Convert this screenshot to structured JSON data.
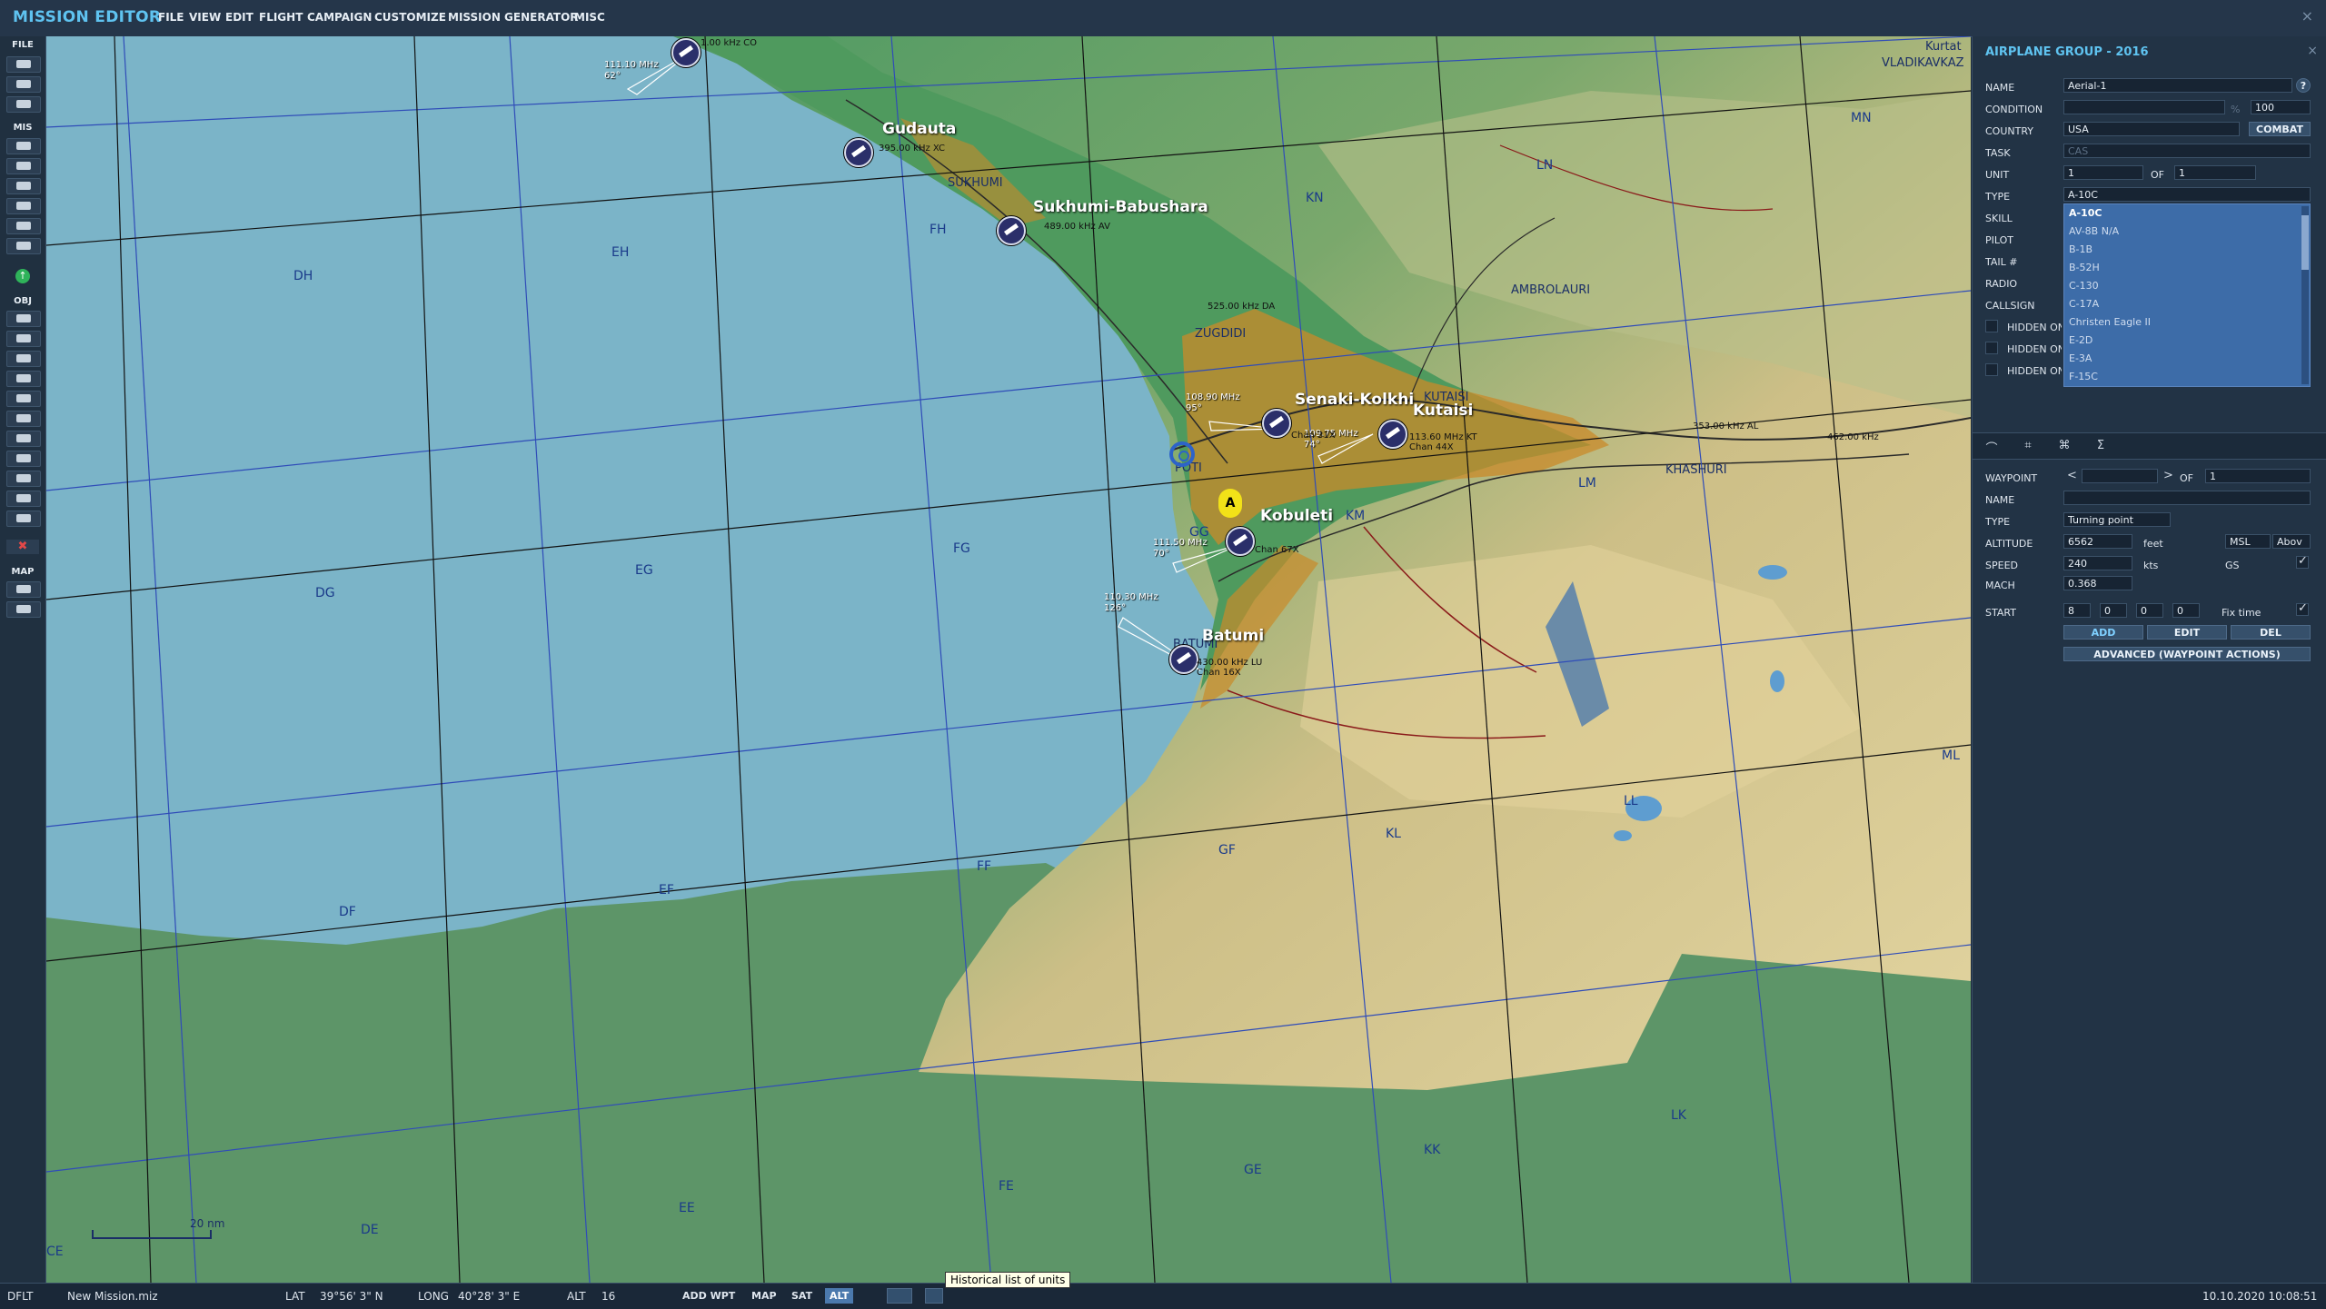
{
  "app": {
    "title": "MISSION EDITOR",
    "menus": [
      "FILE",
      "VIEW",
      "EDIT",
      "FLIGHT",
      "CAMPAIGN",
      "CUSTOMIZE",
      "MISSION GENERATOR",
      "MISC"
    ],
    "close": "×"
  },
  "toolbar": {
    "file_label": "FILE",
    "mis_label": "MIS",
    "obj_label": "OBJ",
    "map_label": "MAP"
  },
  "map": {
    "grid_labels": [
      "DH",
      "EH",
      "FH",
      "DG",
      "EG",
      "FG",
      "GG",
      "DF",
      "EF",
      "FF",
      "GF",
      "DE",
      "EE",
      "FE",
      "GE",
      "KN",
      "LN",
      "MN",
      "KM",
      "LM",
      "KL",
      "LL",
      "ML",
      "KK",
      "LK",
      "CE"
    ],
    "cities": [
      "SUKHUMI",
      "ZUGDIDI",
      "KUTAISI",
      "AMBROLAURI",
      "KHASHURI",
      "BATUMI",
      "VLADIKAVKAZ",
      "Kurtat",
      "POTI"
    ],
    "airfields": [
      "Gudauta",
      "Sukhumi-Babushara",
      "Senaki-Kolkhi",
      "Kutaisi",
      "Kobuleti",
      "Batumi"
    ],
    "freqs": {
      "f1": "111.10 MHz\n62°",
      "f2": "108.90 MHz\n95°",
      "f3": "109.75 MHz\n74°",
      "f4": "111.50 MHz\n70°",
      "f5": "110.30 MHz\n126°"
    },
    "navaids": {
      "n1": "1.00 kHz CO",
      "n2": "395.00 kHz XC",
      "n3": "489.00 kHz AV",
      "n4": "525.00 kHz DA",
      "n5": "Chan 31X",
      "n6": "113.60 MHz KT\nChan 44X",
      "n7": "Chan 67X",
      "n8": "430.00 kHz LU\nChan 16X",
      "n9": "353.00 kHz AL",
      "n10": "462.00 kHz"
    },
    "marker_label": "A",
    "scale_label": "20 nm",
    "tooltip": "Historical list of units"
  },
  "panel": {
    "title": "AIRPLANE GROUP - 2016",
    "labels": {
      "name": "NAME",
      "condition": "CONDITION",
      "country": "COUNTRY",
      "task": "TASK",
      "unit": "UNIT",
      "type": "TYPE",
      "skill": "SKILL",
      "pilot": "PILOT",
      "tail": "TAIL #",
      "radio": "RADIO",
      "callsign": "CALLSIGN",
      "hidden1": "HIDDEN ON",
      "hidden2": "HIDDEN ON",
      "hidden3": "HIDDEN ON",
      "of": "OF"
    },
    "name_value": "Aerial-1",
    "help": "?",
    "condition_pct": "%",
    "condition_value": "100",
    "country_value": "USA",
    "combat_button": "COMBAT",
    "task_value": "CAS",
    "unit_value": "1",
    "unit_of": "1",
    "type_value": "A-10C",
    "type_options": [
      "A-10C",
      "AV-8B N/A",
      "B-1B",
      "B-52H",
      "C-130",
      "C-17A",
      "Christen Eagle II",
      "E-2D",
      "E-3A",
      "F-15C"
    ],
    "waypoint": {
      "labels": {
        "waypoint": "WAYPOINT",
        "of": "OF",
        "name": "NAME",
        "type": "TYPE",
        "altitude": "ALTITUDE",
        "speed": "SPEED",
        "mach": "MACH",
        "start": "START"
      },
      "of_value": "1",
      "type_value": "Turning point",
      "altitude": "6562",
      "altitude_unit": "feet",
      "alt_ref": "MSL",
      "alt_ref2": "Abov",
      "speed": "240",
      "speed_unit": "kts",
      "gs": "GS",
      "mach": "0.368",
      "start_h": "8",
      "start_m": "0",
      "start_s": "0",
      "start_f": "0",
      "fix_time": "Fix time",
      "add": "ADD",
      "edit": "EDIT",
      "del": "DEL",
      "advanced": "ADVANCED (WAYPOINT ACTIONS)"
    }
  },
  "status": {
    "theme": "DFLT",
    "filename": "New Mission.miz",
    "lat_label": "LAT",
    "lat": "39°56' 3\" N",
    "long_label": "LONG",
    "long": "40°28' 3\" E",
    "alt_label": "ALT",
    "alt": "16",
    "add_wpt": "ADD WPT",
    "map_btn": "MAP",
    "sat_btn": "SAT",
    "alt_btn": "ALT",
    "datetime": "10.10.2020 10:08:51"
  },
  "colors": {
    "sea": "#7bb4c8",
    "lowland": "#5f9a6c",
    "highland": "#d8c98c",
    "accent": "#5fc3f0"
  }
}
